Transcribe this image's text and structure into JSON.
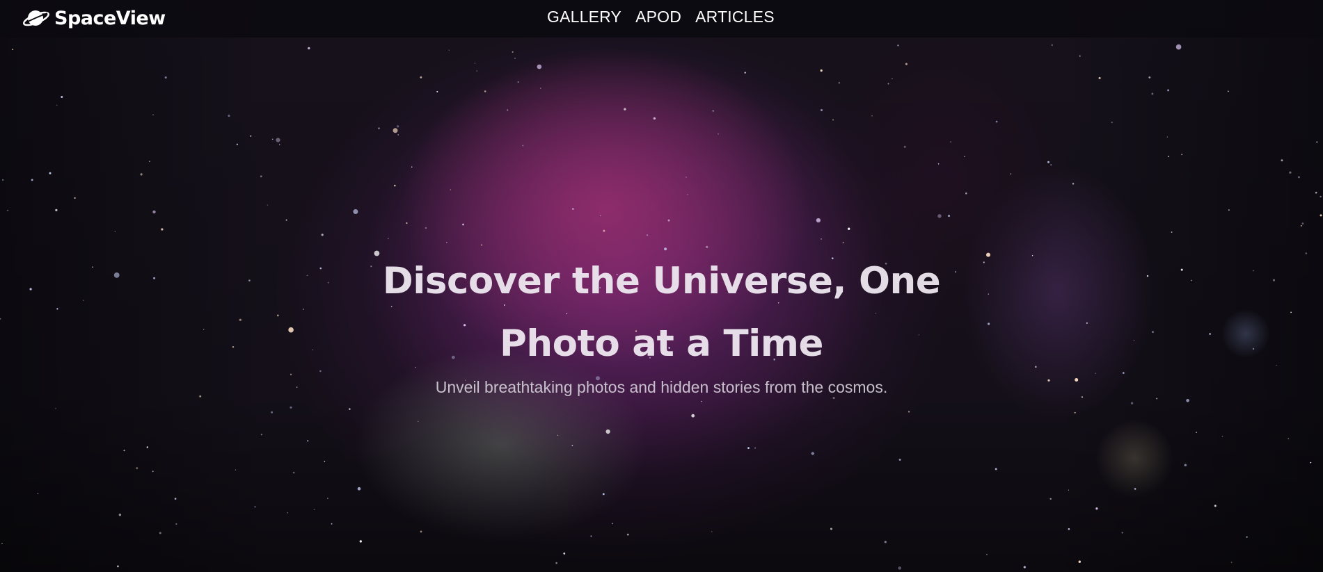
{
  "brand": {
    "name": "SpaceView",
    "icon": "planet-icon"
  },
  "nav": {
    "links": [
      {
        "label": "GALLERY"
      },
      {
        "label": "APOD"
      },
      {
        "label": "ARTICLES"
      }
    ]
  },
  "hero": {
    "title": "Discover the Universe, One Photo at a Time",
    "subtitle": "Unveil breathtaking photos and hidden stories from the cosmos."
  },
  "colors": {
    "nav_background": "#0c0a10",
    "nebula_pink": "#c83c8c",
    "nebula_purple": "#963296",
    "text": "#ffffff"
  }
}
